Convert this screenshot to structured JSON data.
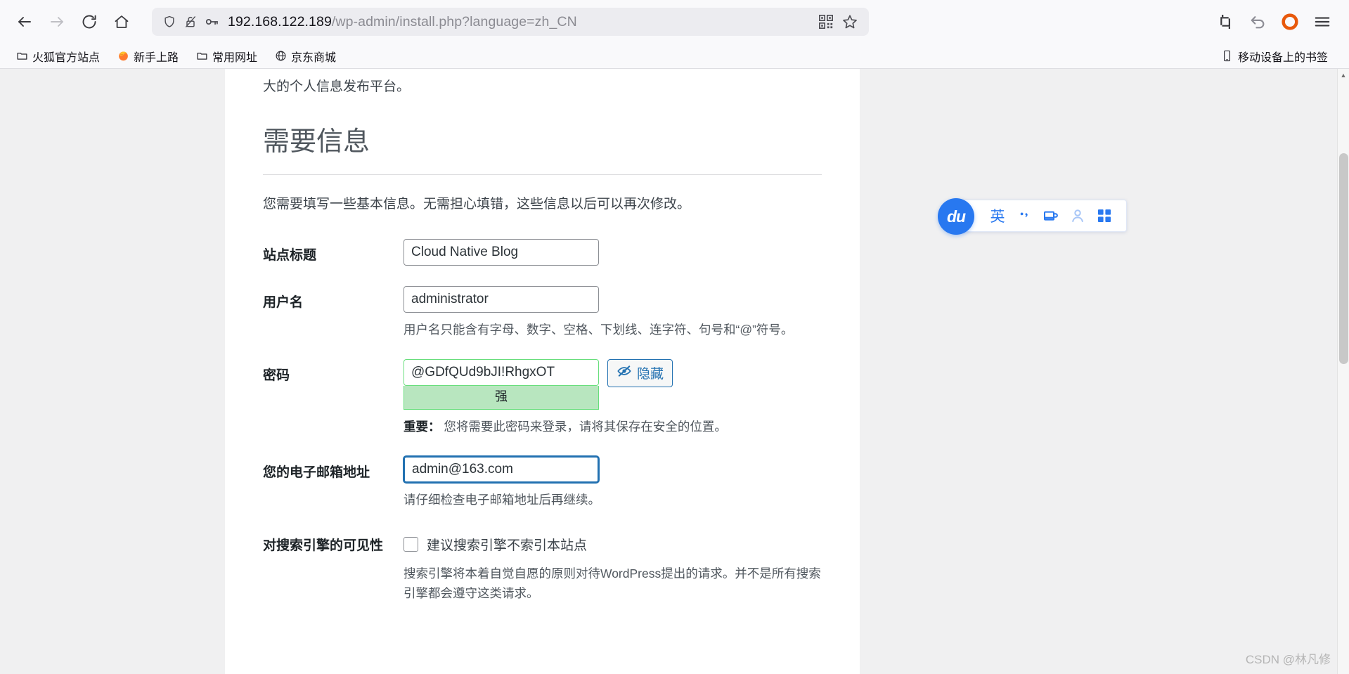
{
  "browser": {
    "nav": {
      "back": "back-arrow",
      "forward": "forward-arrow",
      "reload": "reload",
      "home": "home"
    },
    "url": {
      "host": "192.168.122.189",
      "path": "/wp-admin/install.php?language=zh_CN",
      "full": "192.168.122.189/wp-admin/install.php?language=zh_CN",
      "shield_icon": "tracking-protection-shield-icon",
      "permission_icon": "broken-lock-icon",
      "key_icon": "password-key-icon",
      "qr_icon": "qr-code-icon",
      "star_icon": "bookmark-star-icon"
    },
    "toolbar_right": [
      {
        "name": "screenshot-crop-icon",
        "label": ""
      },
      {
        "name": "undo-close-tab-icon",
        "label": ""
      },
      {
        "name": "orange-circle-icon",
        "label": ""
      },
      {
        "name": "app-menu-icon",
        "label": ""
      }
    ],
    "bookmarks": [
      {
        "label": "火狐官方站点",
        "icon": "folder-icon"
      },
      {
        "label": "新手上路",
        "icon": "firefox-icon"
      },
      {
        "label": "常用网址",
        "icon": "folder-icon"
      },
      {
        "label": "京东商城",
        "icon": "globe-icon"
      }
    ],
    "bookmarks_right": {
      "label": "移动设备上的书签",
      "icon": "mobile-device-icon"
    }
  },
  "page": {
    "intro_tail": "大的个人信息发布平台。",
    "section_title": "需要信息",
    "intro_desc": "您需要填写一些基本信息。无需担心填错，这些信息以后可以再次修改。",
    "fields": {
      "site_title": {
        "label": "站点标题",
        "value": "Cloud Native Blog",
        "placeholder": ""
      },
      "username": {
        "label": "用户名",
        "value": "administrator",
        "placeholder": "",
        "hint": "用户名只能含有字母、数字、空格、下划线、连字符、句号和“@”符号。"
      },
      "password": {
        "label": "密码",
        "value": "@GDfQUd9bJI!RhgxOT",
        "strength": "强",
        "hide_button": "隐藏",
        "hide_icon": "eye-slash-icon",
        "notice_bold": "重要：",
        "notice_text": "您将需要此密码来登录，请将其保存在安全的位置。"
      },
      "email": {
        "label": "您的电子邮箱地址",
        "value": "admin@163.com",
        "placeholder": "",
        "hint": "请仔细检查电子邮箱地址后再继续。"
      },
      "visibility": {
        "label": "对搜索引擎的可见性",
        "checkbox_label": "建议搜索引擎不索引本站点",
        "checked": false,
        "hint": "搜索引擎将本着自觉自愿的原则对待WordPress提出的请求。并不是所有搜索引擎都会遵守这类请求。"
      }
    }
  },
  "ime": {
    "logo": "du",
    "mode": "英",
    "punctuation": "·，",
    "items": [
      {
        "name": "input-mode-english",
        "label": "英"
      },
      {
        "name": "punctuation-toggle-icon",
        "label": ""
      },
      {
        "name": "soft-keyboard-icon",
        "label": ""
      },
      {
        "name": "user-account-icon",
        "label": ""
      },
      {
        "name": "app-grid-icon",
        "label": ""
      }
    ]
  },
  "watermark": "CSDN @林凡修",
  "colors": {
    "accent_blue": "#2271b1",
    "strength_green": "#b8e6bf",
    "ime_blue": "#2878f0",
    "firefox_orange": "#e8590c"
  }
}
